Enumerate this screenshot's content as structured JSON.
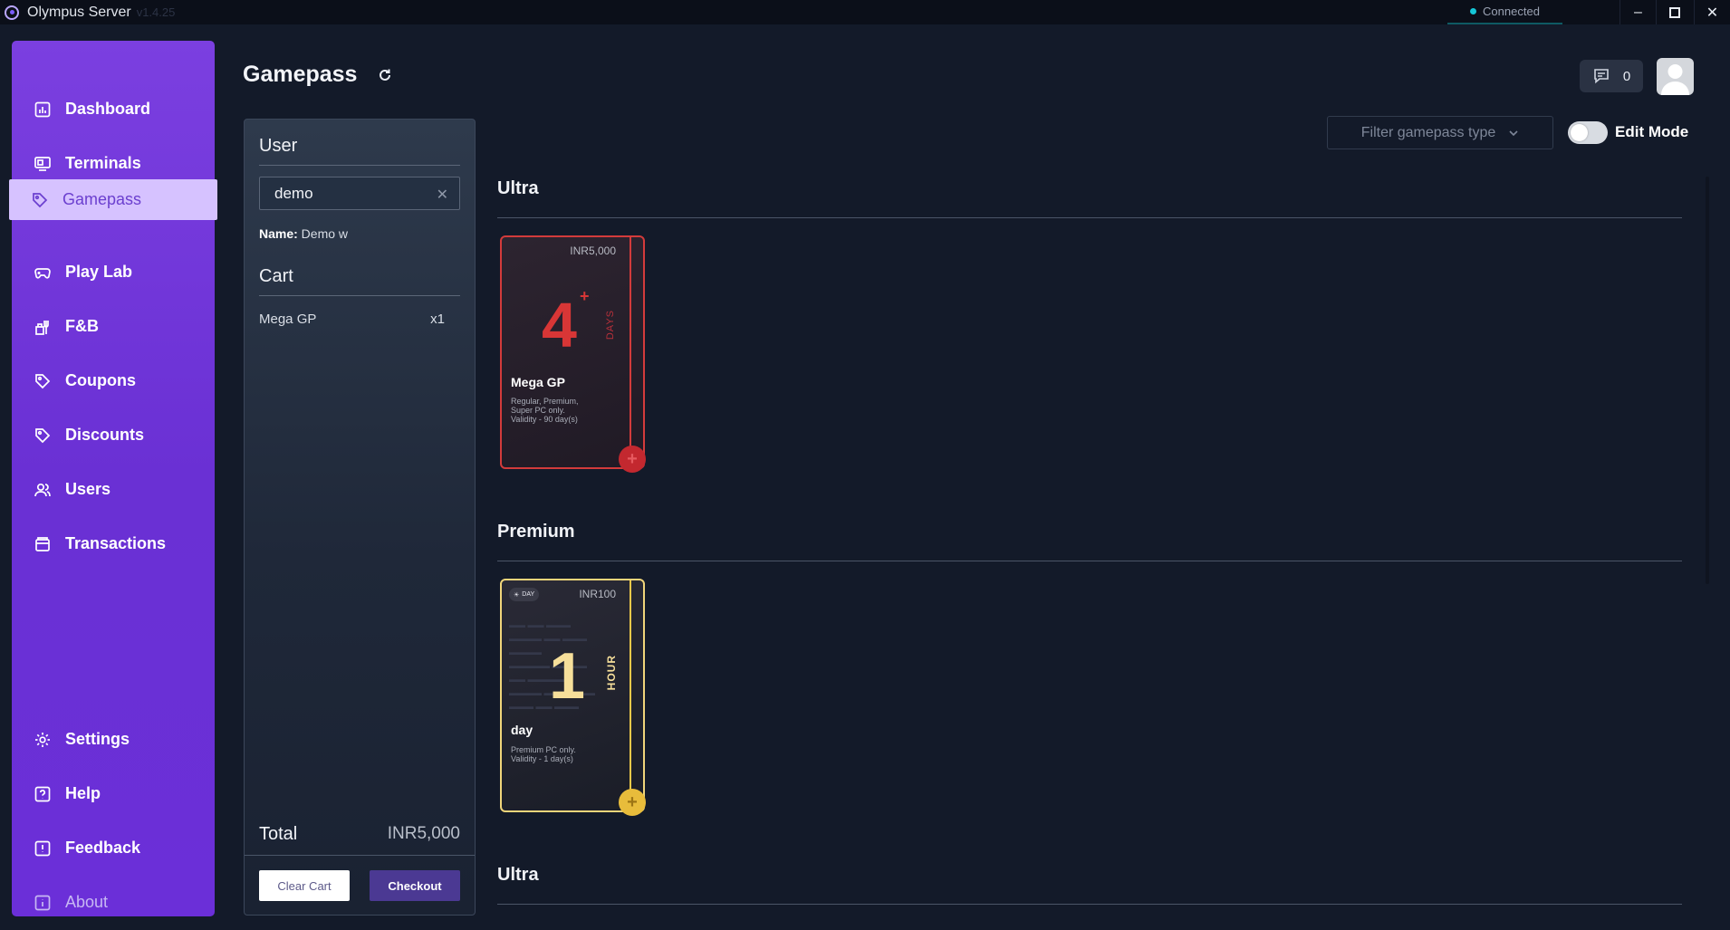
{
  "window": {
    "title": "Olympus Server",
    "version": "v1.4.25",
    "status": "Connected",
    "controls": {
      "minimize": "–",
      "close": "✕"
    }
  },
  "sidebar": {
    "items": [
      {
        "label": "Dashboard",
        "icon": "chart-icon"
      },
      {
        "label": "Terminals",
        "icon": "terminal-icon"
      },
      {
        "label": "Gamepass",
        "icon": "tag-icon",
        "active": true
      },
      {
        "label": "Play Lab",
        "icon": "gamepad-icon"
      },
      {
        "label": "F&B",
        "icon": "food-icon"
      },
      {
        "label": "Coupons",
        "icon": "tag-icon"
      },
      {
        "label": "Discounts",
        "icon": "tag-icon"
      },
      {
        "label": "Users",
        "icon": "users-icon"
      },
      {
        "label": "Transactions",
        "icon": "wallet-icon"
      }
    ],
    "bottom_items": [
      {
        "label": "Settings",
        "icon": "gear-icon"
      },
      {
        "label": "Help",
        "icon": "help-icon"
      },
      {
        "label": "Feedback",
        "icon": "feedback-icon"
      },
      {
        "label": "About",
        "icon": "info-icon"
      }
    ]
  },
  "header": {
    "title": "Gamepass",
    "notification_count": "0"
  },
  "panel": {
    "user_heading": "User",
    "user_input_value": "demo",
    "name_label": "Name:",
    "name_value": " Demo w",
    "cart_heading": "Cart",
    "cart_items": [
      {
        "name": "Mega GP",
        "qty": "x1"
      }
    ],
    "total_label": "Total",
    "total_value": "INR5,000",
    "clear_button": "Clear Cart",
    "checkout_button": "Checkout"
  },
  "toolbar": {
    "filter_placeholder": "Filter gamepass type",
    "edit_mode_label": "Edit Mode",
    "edit_mode_on": false
  },
  "sections": [
    {
      "title": "Ultra",
      "card": {
        "price": "INR5,000",
        "value": "4",
        "plus": "+",
        "unit": "DAYS",
        "name": "Mega GP",
        "desc": [
          "Regular, Premium,",
          "Super PC only.",
          "Validity - 90 day(s)"
        ],
        "color": "#d33b3b"
      }
    },
    {
      "title": "Premium",
      "card": {
        "badge": "DAY",
        "price": "INR100",
        "value": "1",
        "unit": "HOUR",
        "name": "day",
        "desc": [
          "Premium PC only.",
          "Validity - 1 day(s)"
        ],
        "color": "#f0c94a"
      }
    },
    {
      "title": "Ultra"
    }
  ]
}
